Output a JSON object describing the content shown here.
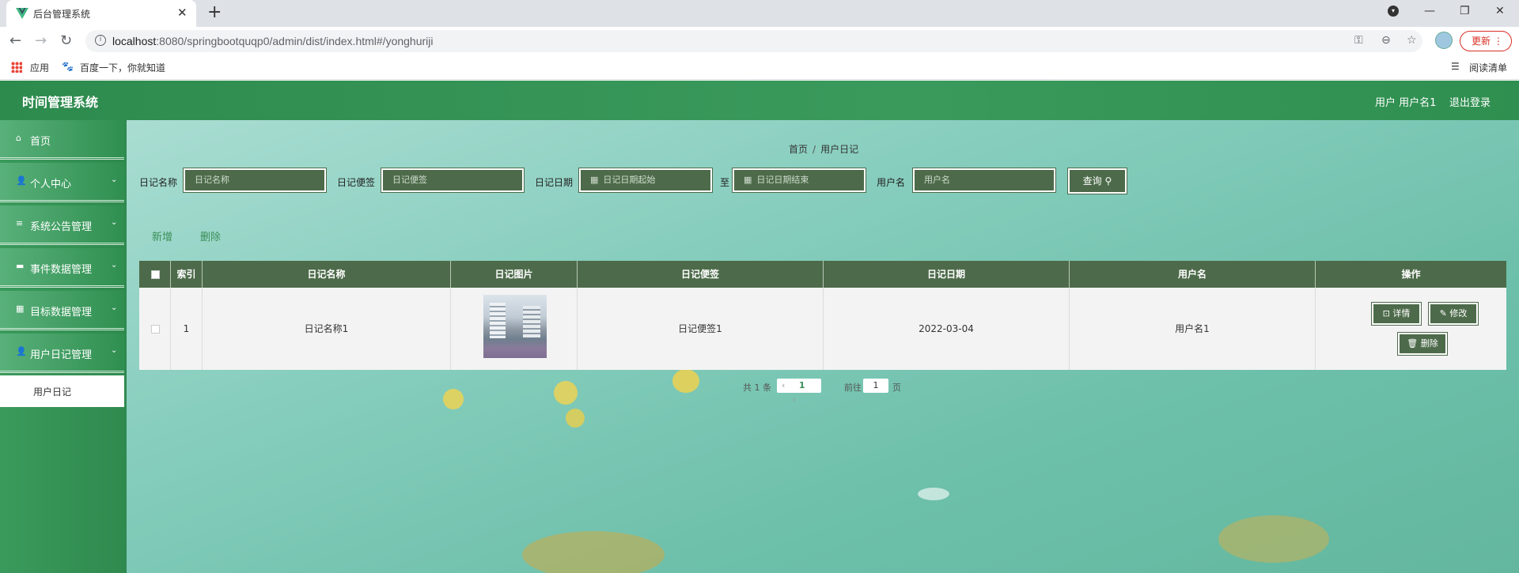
{
  "browser": {
    "tab_title": "后台管理系统",
    "url_host": "localhost",
    "url_rest": ":8080/springbootquqp0/admin/dist/index.html#/yonghuriji",
    "update_label": "更新",
    "bookmarks": [
      "应用",
      "百度一下，你就知道"
    ],
    "reading_list": "阅读清单"
  },
  "header": {
    "title": "时间管理系统",
    "user_label": "用户 用户名1",
    "logout_label": "退出登录"
  },
  "sidebar": {
    "items": [
      {
        "label": "首页",
        "icon": "home-icon"
      },
      {
        "label": "个人中心",
        "icon": "user-icon"
      },
      {
        "label": "系统公告管理",
        "icon": "menu-icon"
      },
      {
        "label": "事件数据管理",
        "icon": "ticket-icon"
      },
      {
        "label": "目标数据管理",
        "icon": "grid-icon"
      },
      {
        "label": "用户日记管理",
        "icon": "user-icon"
      }
    ],
    "sub_item": "用户日记"
  },
  "breadcrumb": {
    "home": "首页",
    "current": "用户日记"
  },
  "search": {
    "name_label": "日记名称",
    "name_placeholder": "日记名称",
    "note_label": "日记便签",
    "note_placeholder": "日记便签",
    "date_label": "日记日期",
    "date_start_placeholder": "日记日期起始",
    "date_sep": "至",
    "date_end_placeholder": "日记日期结束",
    "user_label": "用户名",
    "user_placeholder": "用户名",
    "button": "查询"
  },
  "actions": {
    "add": "新增",
    "delete": "删除"
  },
  "table": {
    "headers": [
      "索引",
      "日记名称",
      "日记图片",
      "日记便签",
      "日记日期",
      "用户名",
      "操作"
    ],
    "rows": [
      {
        "index": "1",
        "name": "日记名称1",
        "note": "日记便签1",
        "date": "2022-03-04",
        "username": "用户名1"
      }
    ],
    "op_labels": {
      "detail": "详情",
      "edit": "修改",
      "delete": "删除"
    }
  },
  "pagination": {
    "total": "共 1 条",
    "current_page": "1",
    "goto_label": "前往",
    "goto_value": "1",
    "page_suffix": "页"
  },
  "colors": {
    "brand_green": "#2e8b4e",
    "table_header": "#4d6b4a",
    "link_green": "#3b8e58"
  }
}
